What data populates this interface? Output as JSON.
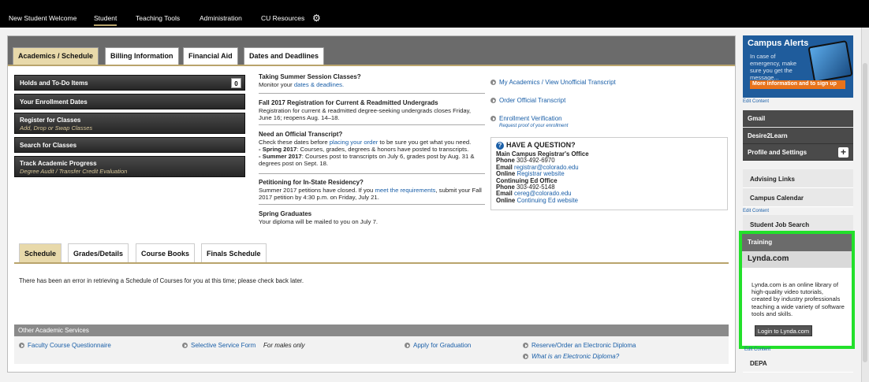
{
  "topnav": {
    "items": [
      "New Student Welcome",
      "Student",
      "Teaching Tools",
      "Administration",
      "CU Resources"
    ],
    "active": "Student"
  },
  "top_tabs": [
    "Academics / Schedule",
    "Billing Information",
    "Financial Aid",
    "Dates and Deadlines"
  ],
  "actions": {
    "holds": "Holds and To-Do Items",
    "holds_count": "0",
    "enrollment": "Your Enrollment Dates",
    "register": "Register for Classes",
    "register_sub": "Add, Drop or Swap Classes",
    "search": "Search for Classes",
    "track": "Track Academic Progress",
    "track_sub": "Degree Audit / Transfer Credit Evaluation"
  },
  "news": {
    "n1_title": "Taking Summer Session Classes?",
    "n1_text_pre": "Monitor your ",
    "n1_link": "dates & deadlines.",
    "n2_title": "Fall 2017 Registration for Current & Readmitted Undergrads",
    "n2_text": "Registration for current & readmitted degree-seeking undergrads closes Friday, June 16; reopens Aug. 14–18.",
    "n3_title": "Need an Official Transcript?",
    "n3_text_pre": "Check these dates before ",
    "n3_link": "placing your order",
    "n3_text_post": " to be sure you get what you need.",
    "n3_b1_label": "- Spring 2017",
    "n3_b1_text": ": Courses, grades, degrees & honors have posted to transcripts.",
    "n3_b2_label": "- Summer 2017",
    "n3_b2_text": ": Courses post to transcripts on July 6, grades post by Aug. 31 & degrees post on Sept. 18.",
    "n4_title": "Petitioning for In-State Residency?",
    "n4_text_pre": "Summer 2017 petitions have closed. If you ",
    "n4_link": "meet the requirements",
    "n4_text_post": ", submit your Fall 2017 petition by 4:30 p.m. on Friday, July 21.",
    "n5_title": "Spring Graduates",
    "n5_text": "Your diploma will be mailed to you on July 7."
  },
  "right_links": {
    "my_academics": "My Academics / View Unofficial Transcript",
    "official_transcript": "Order Official Transcript",
    "enrollment_verification": "Enrollment Verification",
    "enrollment_sub": "Request proof of your enrollment"
  },
  "question": {
    "title": "HAVE A QUESTION?",
    "main_office": "Main Campus Registrar's Office",
    "phone_label": "Phone",
    "main_phone": "303-492-6970",
    "email_label": "Email",
    "main_email": "registrar@colorado.edu",
    "online_label": "Online",
    "main_online": "Registrar website",
    "ce_office": "Continuing Ed Office",
    "ce_phone": "303-492-5148",
    "ce_email": "cereg@colorado.edu",
    "ce_online": "Continuing Ed website"
  },
  "lower_tabs": [
    "Schedule",
    "Grades/Details",
    "Course Books",
    "Finals Schedule"
  ],
  "schedule_message": "There has been an error in retrieving a Schedule of Courses for you at this time; please check back later.",
  "other_services": {
    "header": "Other Academic Services",
    "fcq": "Faculty Course Questionnaire",
    "selective": "Selective Service Form",
    "males": "For males only",
    "graduation": "Apply for Graduation",
    "diploma": "Reserve/Order an Electronic Diploma",
    "what_diploma": "What is an Electronic Diploma?"
  },
  "sidebar": {
    "alerts_title": "Campus Alerts",
    "alerts_text": "In case of emergency, make sure you get the message...",
    "alerts_button": "More information and to sign up",
    "edit_content": "Edit Content",
    "gmail": "Gmail",
    "desire2learn": "Desire2Learn",
    "profile": "Profile and Settings",
    "plus": "+",
    "advising": "Advising Links",
    "calendar": "Campus Calendar",
    "jobs": "Student Job Search",
    "training": "Training",
    "lynda_title": "Lynda.com",
    "lynda_desc": "Lynda.com is an online library of high-quality video tutorials, created by industry professionals teaching a wide variety of software tools and skills.",
    "lynda_button": "Login to Lynda.com",
    "edit_content_partial": "Edit Content",
    "depa": "DEPA"
  }
}
